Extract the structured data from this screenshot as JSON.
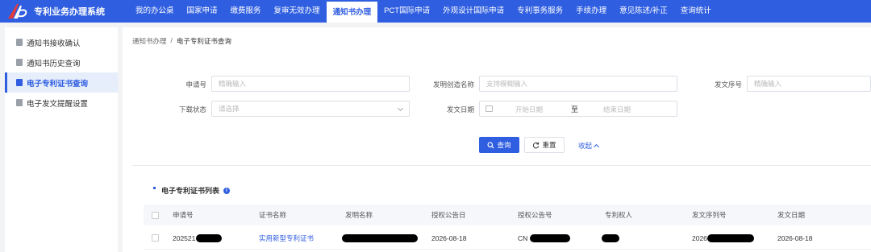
{
  "app": {
    "title": "专利业务办理系统"
  },
  "nav": [
    {
      "label": "我的办公桌"
    },
    {
      "label": "国家申请"
    },
    {
      "label": "缴费服务"
    },
    {
      "label": "复审无效办理"
    },
    {
      "label": "通知书办理",
      "active": true
    },
    {
      "label": "PCT国际申请"
    },
    {
      "label": "外观设计国际申请"
    },
    {
      "label": "专利事务服务"
    },
    {
      "label": "手续办理"
    },
    {
      "label": "意见陈述/补正"
    },
    {
      "label": "查询统计"
    }
  ],
  "sidebar": {
    "items": [
      {
        "label": "通知书接收确认"
      },
      {
        "label": "通知书历史查询"
      },
      {
        "label": "电子专利证书查询",
        "active": true
      },
      {
        "label": "电子发文提醒设置"
      }
    ]
  },
  "breadcrumb": {
    "parent": "通知书办理",
    "sep": "/",
    "current": "电子专利证书查询"
  },
  "form": {
    "app_no_label": "申请号",
    "app_no_placeholder": "精确输入",
    "invention_label": "发明创造名称",
    "invention_placeholder": "支持模糊输入",
    "doc_serial_label": "发文序号",
    "doc_serial_placeholder": "精确输入",
    "download_label": "下载状态",
    "download_placeholder": "请选择",
    "doc_date_label": "发文日期",
    "date_start_placeholder": "开始日期",
    "date_separator": "至",
    "date_end_placeholder": "结束日期"
  },
  "buttons": {
    "query": "查询",
    "reset": "重置",
    "collapse": "收起"
  },
  "list": {
    "title": "电子专利证书列表",
    "columns": [
      "申请号",
      "证书名称",
      "发明名称",
      "授权公告日",
      "授权公告号",
      "专利权人",
      "发文序列号",
      "发文日期"
    ],
    "rows": [
      {
        "app_no": "202521",
        "cert_name": "实用新型专利证书",
        "invention": "",
        "grant_date": "2026-08-18",
        "grant_no": "CN",
        "patentee": "",
        "serial_no": "2026",
        "doc_date": "2026-08-18"
      }
    ]
  },
  "colors": {
    "primary": "#2f5ee0",
    "background": "#f2f3f5"
  }
}
